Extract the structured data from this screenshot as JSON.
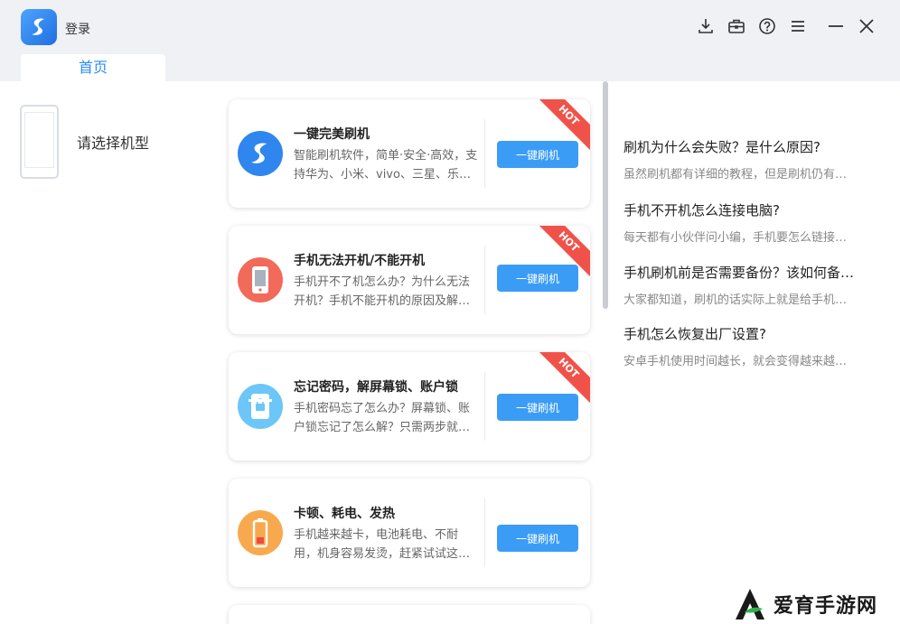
{
  "header": {
    "login_label": "登录",
    "icons": [
      "download-icon",
      "toolbox-icon",
      "help-icon",
      "menu-icon",
      "minimize-icon",
      "close-icon"
    ]
  },
  "tabs": [
    {
      "label": "首页"
    }
  ],
  "model_picker": {
    "label": "请选择机型"
  },
  "cards": [
    {
      "title": "一键完美刷机",
      "desc": "智能刷机软件，简单·安全·高效，支持华为、小米、vivo、三星、乐…",
      "button": "一键刷机",
      "badge": "HOT",
      "icon": "app-logo-icon",
      "color": "#2f86ee"
    },
    {
      "title": "手机无法开机/不能开机",
      "desc": "手机开不了机怎么办？为什么无法开机？手机不能开机的原因及解…",
      "button": "一键刷机",
      "badge": "HOT",
      "icon": "phone-icon",
      "color": "#f26a5a"
    },
    {
      "title": "忘记密码，解屏幕锁、账户锁",
      "desc": "手机密码忘了怎么办？屏幕锁、账户锁忘记了怎么解？只需两步就…",
      "button": "一键刷机",
      "badge": "HOT",
      "icon": "lock-icon",
      "color": "#6cc6f7"
    },
    {
      "title": "卡顿、耗电、发热",
      "desc": "手机越来越卡，电池耗电、不耐用，机身容易发烫，赶紧试试这…",
      "button": "一键刷机",
      "badge": "",
      "icon": "battery-icon",
      "color": "#f8a94e"
    }
  ],
  "articles": [
    {
      "title": "刷机为什么会失败？是什么原因?",
      "sub": "虽然刷机都有详细的教程，但是刷机仍有…"
    },
    {
      "title": "手机不开机怎么连接电脑?",
      "sub": "每天都有小伙伴问小编，手机要怎么链接…"
    },
    {
      "title": "手机刷机前是否需要备份？该如何备…",
      "sub": "大家都知道，刷机的话实际上就是给手机…"
    },
    {
      "title": "手机怎么恢复出厂设置?",
      "sub": "安卓手机使用时间越长，就会变得越来越…"
    }
  ],
  "watermark": {
    "text": "爱育手游网"
  }
}
